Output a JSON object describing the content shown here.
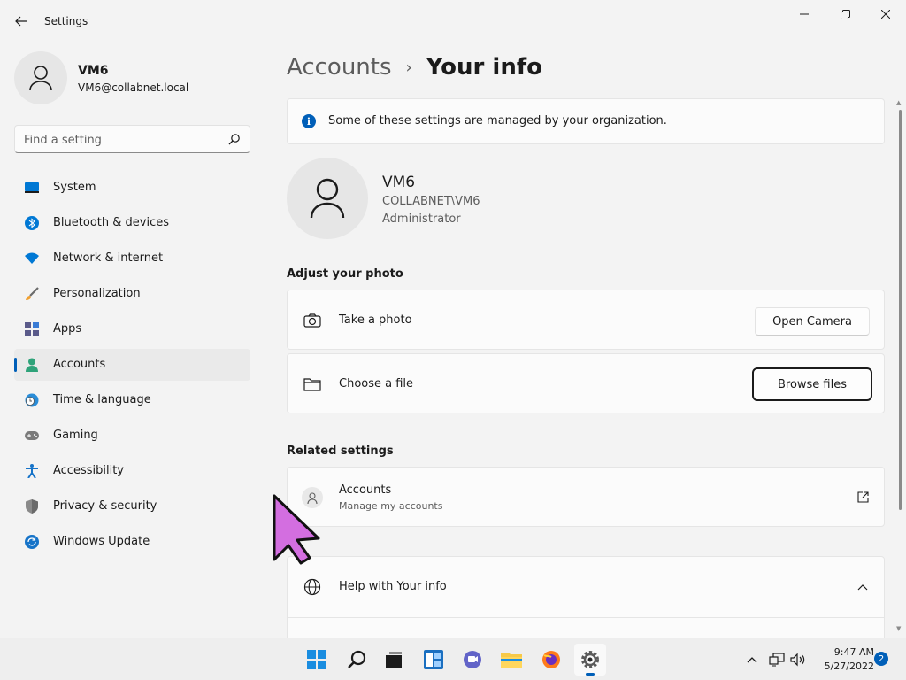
{
  "window": {
    "title": "Settings"
  },
  "profile": {
    "name": "VM6",
    "email": "VM6@collabnet.local"
  },
  "search": {
    "placeholder": "Find a setting"
  },
  "nav": {
    "items": [
      {
        "label": "System",
        "icon": "monitor-icon"
      },
      {
        "label": "Bluetooth & devices",
        "icon": "bluetooth-icon"
      },
      {
        "label": "Network & internet",
        "icon": "wifi-icon"
      },
      {
        "label": "Personalization",
        "icon": "brush-icon"
      },
      {
        "label": "Apps",
        "icon": "apps-icon"
      },
      {
        "label": "Accounts",
        "icon": "person-icon",
        "active": true
      },
      {
        "label": "Time & language",
        "icon": "globe-clock-icon"
      },
      {
        "label": "Gaming",
        "icon": "gamepad-icon"
      },
      {
        "label": "Accessibility",
        "icon": "accessibility-icon"
      },
      {
        "label": "Privacy & security",
        "icon": "shield-icon"
      },
      {
        "label": "Windows Update",
        "icon": "update-icon"
      }
    ]
  },
  "breadcrumb": {
    "parent": "Accounts",
    "separator": "›",
    "current": "Your info"
  },
  "info_bar": {
    "text": "Some of these settings are managed by your organization."
  },
  "user": {
    "name": "VM6",
    "domain": "COLLABNET\\VM6",
    "role": "Administrator"
  },
  "adjust_photo": {
    "header": "Adjust your photo",
    "take_photo": {
      "label": "Take a photo",
      "button": "Open Camera"
    },
    "choose_file": {
      "label": "Choose a file",
      "button": "Browse files"
    }
  },
  "related": {
    "header": "Related settings",
    "accounts": {
      "title": "Accounts",
      "subtitle": "Manage my accounts"
    }
  },
  "help": {
    "title": "Help with Your info"
  },
  "taskbar": {
    "apps": [
      "start-icon",
      "search-icon",
      "task-view-icon",
      "widgets-icon",
      "chat-icon",
      "file-explorer-icon",
      "firefox-icon",
      "settings-icon"
    ],
    "time": "9:47 AM",
    "date": "5/27/2022",
    "notifications": "2"
  },
  "colors": {
    "accent": "#005fb8",
    "background": "#f3f3f3",
    "card": "#fbfbfb",
    "cursor": "#d36ee0"
  }
}
